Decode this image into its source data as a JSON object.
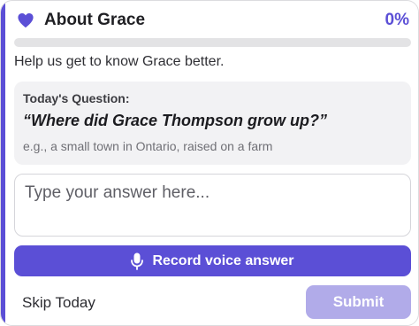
{
  "header": {
    "icon": "heart-icon",
    "title": "About Grace",
    "progress_label": "0%",
    "progress_value": 0
  },
  "intro_text": "Help us get to know Grace better.",
  "question": {
    "label": "Today's Question:",
    "text": "“Where did Grace Thompson grow up?”",
    "hint": "e.g., a small town in Ontario, raised on a farm"
  },
  "answer": {
    "placeholder": "Type your answer here...",
    "value": ""
  },
  "record_button": {
    "icon": "microphone-icon",
    "label": "Record voice answer"
  },
  "footer": {
    "skip_label": "Skip Today",
    "submit_label": "Submit"
  },
  "colors": {
    "accent": "#5b4fd6",
    "submit_disabled": "#b1abe9",
    "track": "#e3e3e5",
    "question_bg": "#f2f2f4"
  }
}
